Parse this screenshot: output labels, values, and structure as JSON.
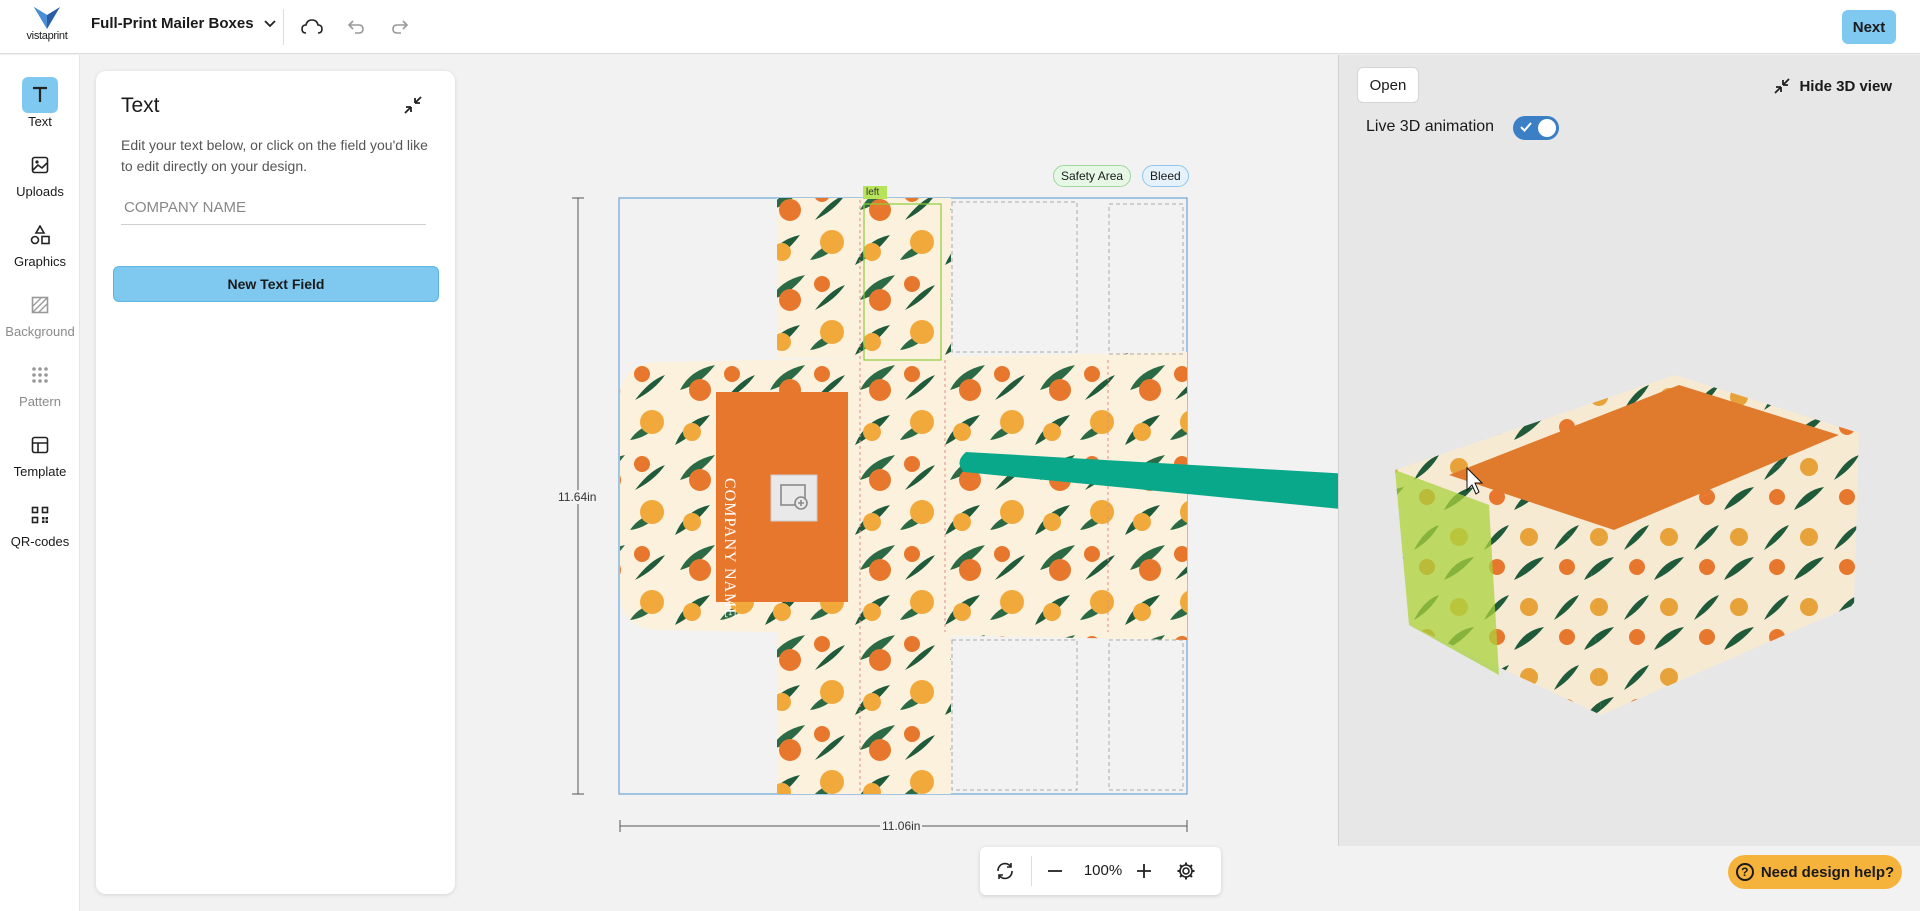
{
  "brand": {
    "name": "vistaprint"
  },
  "header": {
    "product_title": "Full-Print Mailer Boxes",
    "next_label": "Next"
  },
  "rail": {
    "items": [
      {
        "label": "Text",
        "icon": "text-icon",
        "active": true
      },
      {
        "label": "Uploads",
        "icon": "image-icon"
      },
      {
        "label": "Graphics",
        "icon": "shapes-icon"
      },
      {
        "label": "Background",
        "icon": "background-icon",
        "disabled": true
      },
      {
        "label": "Pattern",
        "icon": "pattern-icon",
        "disabled": true
      },
      {
        "label": "Template",
        "icon": "template-icon"
      },
      {
        "label": "QR-codes",
        "icon": "qr-code-icon"
      }
    ]
  },
  "text_panel": {
    "title": "Text",
    "description": "Edit your text below, or click on the field you'd like to edit directly on your design.",
    "input_placeholder": "COMPANY NAME",
    "input_value": "",
    "new_field_label": "New Text Field"
  },
  "canvas": {
    "legend_safety": "Safety Area",
    "legend_bleed": "Bleed",
    "height_label": "11.64in",
    "width_label": "11.06in",
    "panel_tag": "left",
    "design_text": "COMPANY NAME",
    "colors": {
      "orange": "#e8772e",
      "cream": "#fbf1dc",
      "leaf": "#1f5a3a",
      "arrow": "#0aa88a"
    }
  },
  "zoom": {
    "value": "100%"
  },
  "view3d": {
    "open_label": "Open",
    "hide_label": "Hide 3D view",
    "live_animation_label": "Live 3D animation",
    "live_animation_on": true
  },
  "help": {
    "label": "Need design help?"
  }
}
